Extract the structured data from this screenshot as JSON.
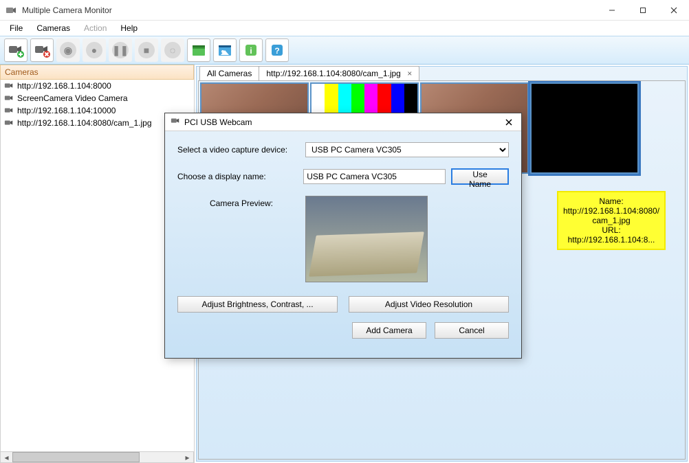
{
  "app": {
    "title": "Multiple Camera Monitor"
  },
  "menu": {
    "file": "File",
    "cameras": "Cameras",
    "action": "Action",
    "help": "Help"
  },
  "sidebar": {
    "header": "Cameras",
    "items": [
      {
        "label": "http://192.168.1.104:8000"
      },
      {
        "label": "ScreenCamera Video Camera"
      },
      {
        "label": "http://192.168.1.104:10000"
      },
      {
        "label": "http://192.168.1.104:8080/cam_1.jpg"
      }
    ]
  },
  "tabs": {
    "all": "All Cameras",
    "current": "http://192.168.1.104:8080/cam_1.jpg"
  },
  "infobox": {
    "name_lbl": "Name:",
    "name_val": "http://192.168.1.104:8080/cam_1.jpg",
    "url_lbl": "URL:",
    "url_val": "http://192.168.1.104:8..."
  },
  "dialog": {
    "title": "PCI USB Webcam",
    "select_label": "Select a video capture device:",
    "select_value": "USB PC Camera VC305",
    "name_label": "Choose a display name:",
    "name_value": "USB PC Camera VC305",
    "use_name": "Use Name",
    "preview_label": "Camera Preview:",
    "brightness_btn": "Adjust Brightness, Contrast, ...",
    "resolution_btn": "Adjust Video Resolution",
    "add_btn": "Add Camera",
    "cancel_btn": "Cancel"
  },
  "colors": {
    "accent": "#2a7de1"
  }
}
